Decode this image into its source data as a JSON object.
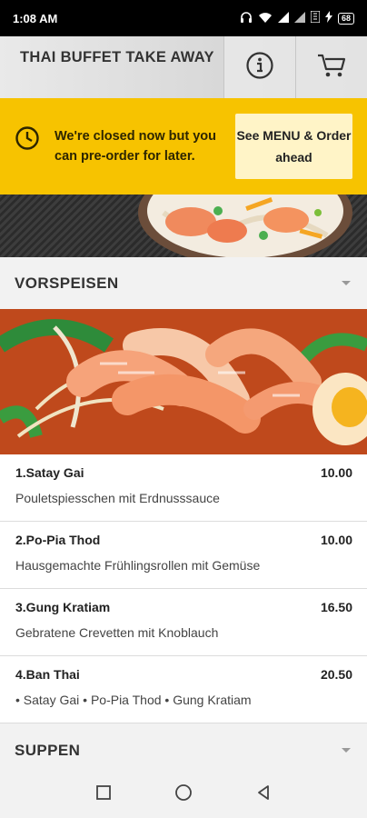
{
  "status_bar": {
    "time": "1:08 AM",
    "battery": "68",
    "icons": [
      "headphones-icon",
      "wifi-icon",
      "signal-icon",
      "signal-icon",
      "data-icon",
      "charging-icon",
      "battery-icon"
    ]
  },
  "header": {
    "title": "THAI BUFFET TAKE AWAY",
    "info_icon": "info-icon",
    "cart_icon": "cart-icon"
  },
  "banner": {
    "text": "We're closed now but you can pre-order for later.",
    "button_label": "See MENU & Order ahead",
    "icon": "clock-icon"
  },
  "sections": [
    {
      "title": "VORSPEISEN",
      "expanded": true
    },
    {
      "title": "SUPPEN",
      "expanded": false
    }
  ],
  "menu_items": [
    {
      "name": "1.Satay Gai",
      "price": "10.00",
      "description": "Pouletspiesschen mit Erdnusssauce"
    },
    {
      "name": "2.Po-Pia Thod",
      "price": "10.00",
      "description": "Hausgemachte Frühlingsrollen mit Gemüse"
    },
    {
      "name": "3.Gung Kratiam",
      "price": "16.50",
      "description": "Gebratene Crevetten mit Knoblauch"
    },
    {
      "name": "4.Ban Thai",
      "price": "20.50",
      "description": "• Satay Gai • Po-Pia Thod • Gung Kratiam"
    }
  ],
  "nav": {
    "recent_icon": "square-icon",
    "home_icon": "circle-icon",
    "back_icon": "triangle-back-icon"
  },
  "colors": {
    "banner_bg": "#f7c300",
    "banner_button_bg": "#fff4c7"
  }
}
